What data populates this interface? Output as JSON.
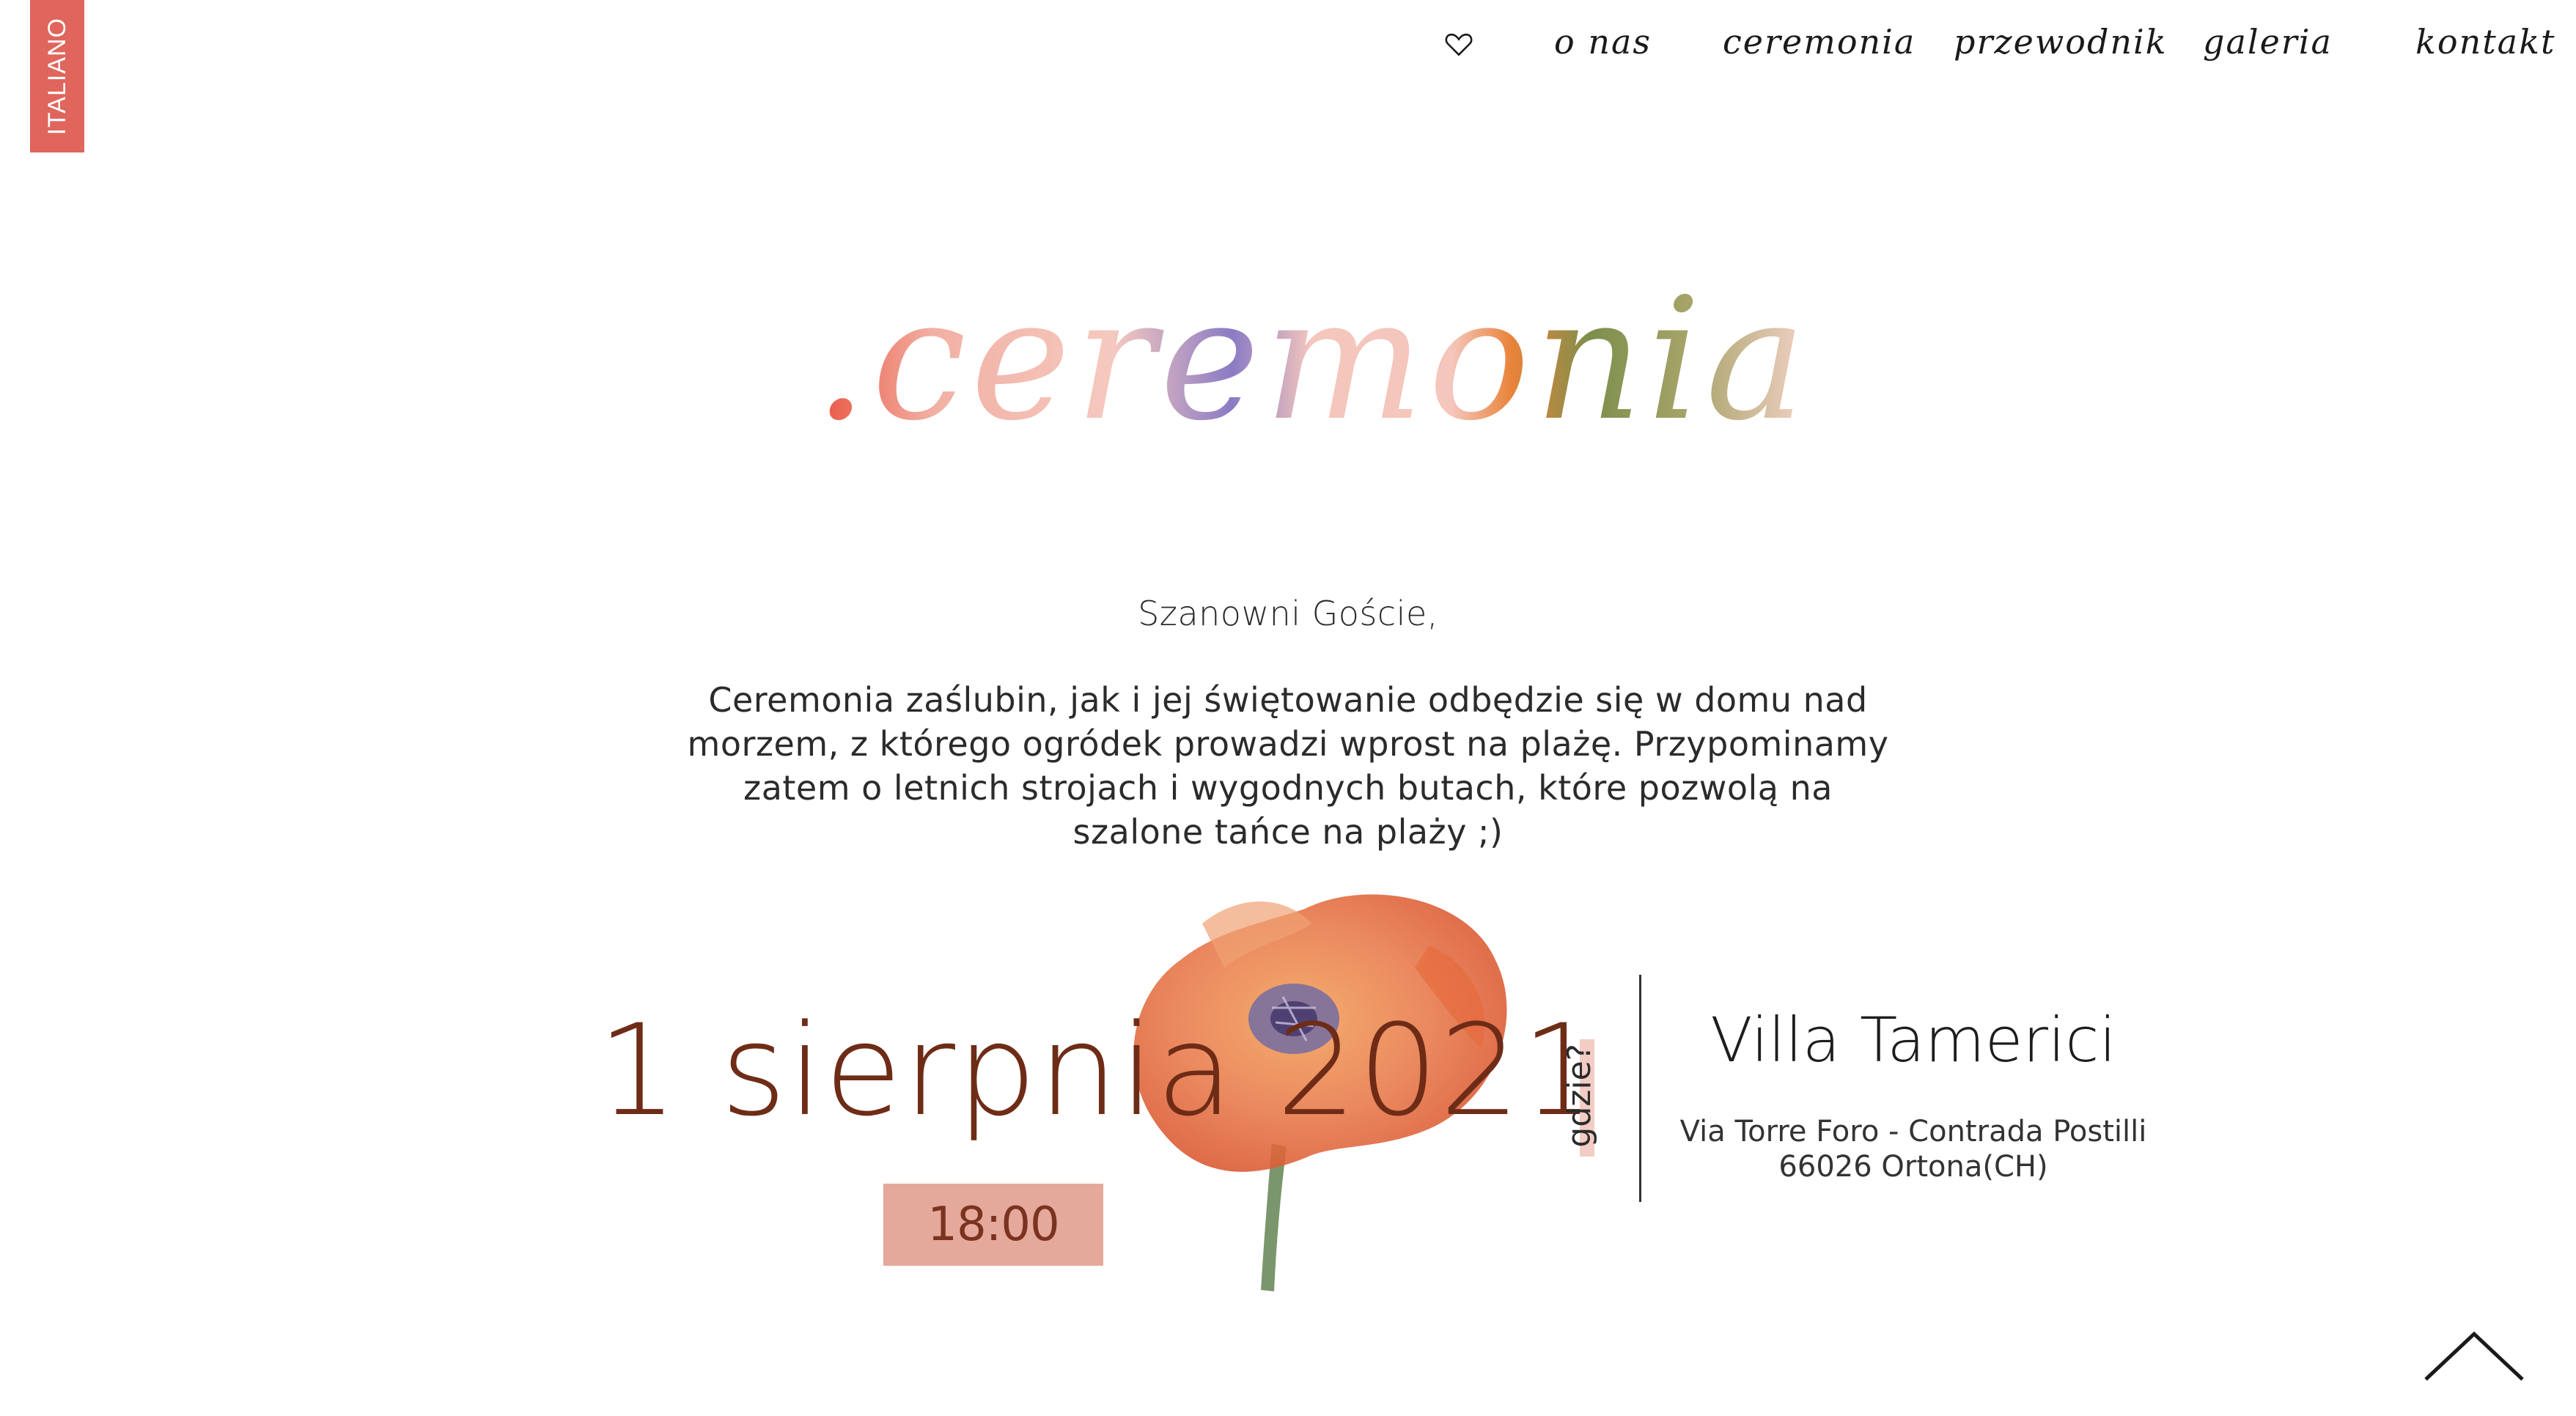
{
  "lang_toggle": {
    "label": "ITALIANO"
  },
  "nav": {
    "home_icon": "heart-icon",
    "items": [
      {
        "label": "o nas"
      },
      {
        "label": "ceremonia"
      },
      {
        "label": "przewodnik"
      },
      {
        "label": "galeria"
      },
      {
        "label": "kontakt"
      }
    ]
  },
  "page": {
    "title": ".ceremonia",
    "greeting": "Szanowni Goście,",
    "paragraph": "Ceremonia zaślubin, jak i jej świętowanie odbędzie się w domu nad morzem, z którego ogródek prowadzi wprost na plażę. Przypominamy zatem o letnich strojach i wygodnych butach, które pozwolą na szalone tańce na plaży ;)"
  },
  "event": {
    "date": "1 sierpnia 2021",
    "time": "18:00",
    "where_label": "gdzie?",
    "venue_name": "Villa Tamerici",
    "address_line1": "Via Torre Foro - Contrada Postilli",
    "address_line2": "66026 Ortona(CH)"
  },
  "back_to_top_icon": "chevron-up-icon",
  "colors": {
    "accent": "#e0655c",
    "date_text": "#6e2c17",
    "time_badge": "#e5a99b",
    "title_pink": "#f4c6bc"
  }
}
